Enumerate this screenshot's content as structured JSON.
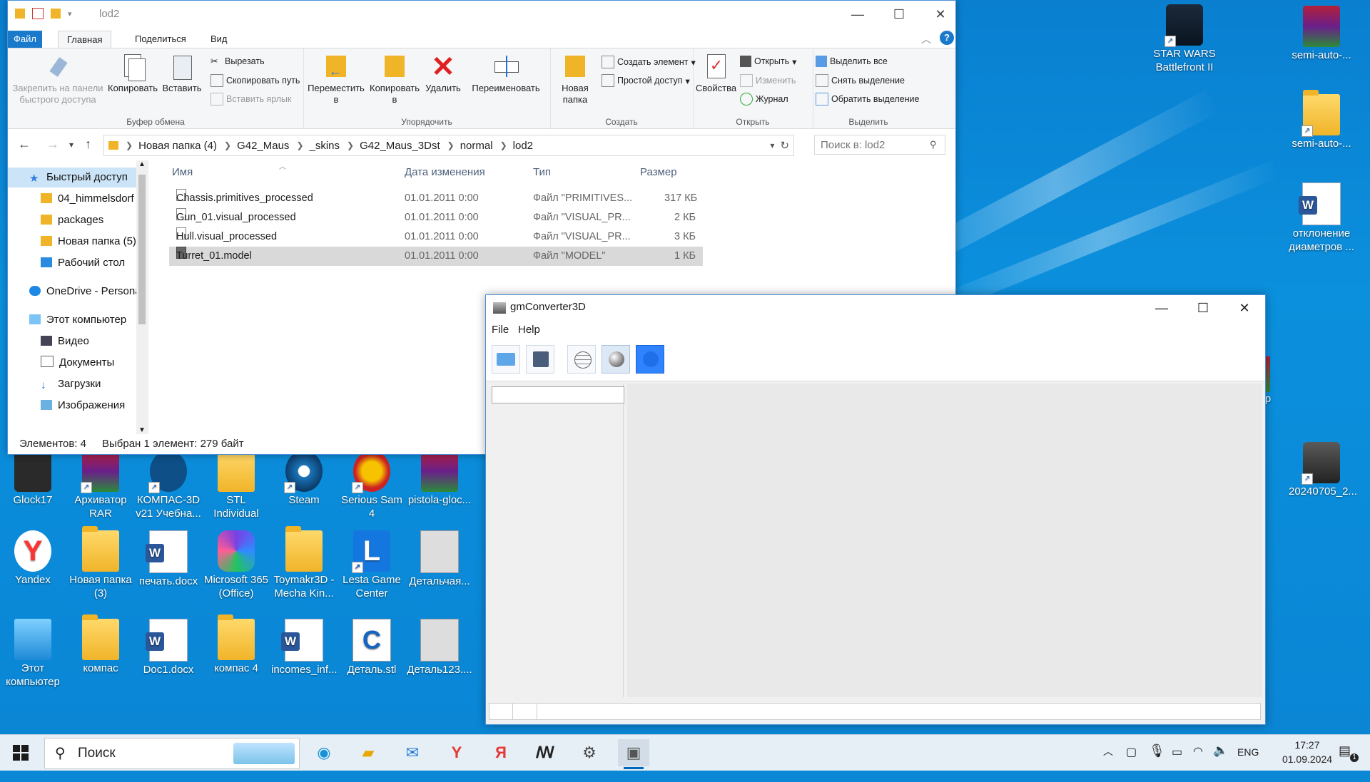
{
  "explorer": {
    "title": "lod2",
    "tabs": [
      "Файл",
      "Главная",
      "Поделиться",
      "Вид"
    ],
    "ribbon": {
      "clipboard": {
        "pin": "Закрепить на панели быстрого доступа",
        "copy": "Копировать",
        "paste": "Вставить",
        "cut": "Вырезать",
        "copy_path": "Скопировать путь",
        "paste_shortcut": "Вставить ярлык",
        "group": "Буфер обмена"
      },
      "organize": {
        "move_to": "Переместить в",
        "copy_to": "Копировать в",
        "delete": "Удалить",
        "rename": "Переименовать",
        "group": "Упорядочить"
      },
      "new": {
        "new_folder": "Новая папка",
        "new_item": "Создать элемент",
        "easy_access": "Простой доступ",
        "group": "Создать"
      },
      "open": {
        "properties": "Свойства",
        "open": "Открыть",
        "edit": "Изменить",
        "history": "Журнал",
        "group": "Открыть"
      },
      "select": {
        "select_all": "Выделить все",
        "select_none": "Снять выделение",
        "invert": "Обратить выделение",
        "group": "Выделить"
      }
    },
    "breadcrumbs": [
      "Новая папка (4)",
      "G42_Maus",
      "_skins",
      "G42_Maus_3Dst",
      "normal",
      "lod2"
    ],
    "search_placeholder": "Поиск в: lod2",
    "nav": [
      "Быстрый доступ",
      "04_himmelsdorf",
      "packages",
      "Новая папка (5)",
      "Рабочий стол",
      "OneDrive - Personal",
      "Этот компьютер",
      "Видео",
      "Документы",
      "Загрузки",
      "Изображения"
    ],
    "columns": [
      "Имя",
      "Дата изменения",
      "Тип",
      "Размер"
    ],
    "files": [
      {
        "name": "Chassis.primitives_processed",
        "date": "01.01.2011 0:00",
        "type": "Файл \"PRIMITIVES...",
        "size": "317 КБ"
      },
      {
        "name": "Gun_01.visual_processed",
        "date": "01.01.2011 0:00",
        "type": "Файл \"VISUAL_PR...",
        "size": "2 КБ"
      },
      {
        "name": "Hull.visual_processed",
        "date": "01.01.2011 0:00",
        "type": "Файл \"VISUAL_PR...",
        "size": "3 КБ"
      },
      {
        "name": "Turret_01.model",
        "date": "01.01.2011 0:00",
        "type": "Файл \"MODEL\"",
        "size": "1 КБ"
      }
    ],
    "status_count": "Элементов: 4",
    "status_selected": "Выбран 1 элемент: 279 байт"
  },
  "gm": {
    "title": "gmConverter3D",
    "menu": [
      "File",
      "Help"
    ]
  },
  "desktop": {
    "icons": [
      "STAR WARS Battlefront II",
      "semi-auto-...",
      "semi-auto-...",
      "отклонение диаметров ...",
      "20240705_2...",
      "zip",
      "Glock17",
      "Архиватор RAR",
      "КОМПАС-3D v21 Учебна...",
      "STL Individual",
      "Steam",
      "Serious Sam 4",
      "pistola-gloc...",
      "Yandex",
      "Новая папка (3)",
      "печать.docx",
      "Microsoft 365 (Office)",
      "Toymakr3D - Mecha Kin...",
      "Lesta Game Center",
      "Детальчая...",
      "Этот компьютер",
      "компас",
      "Doc1.docx",
      "компас 4",
      "incomes_inf...",
      "Деталь.stl",
      "Деталь123...."
    ]
  },
  "taskbar": {
    "search": "Поиск",
    "lang": "ENG",
    "time": "17:27",
    "date": "01.09.2024",
    "notifications": "1"
  }
}
